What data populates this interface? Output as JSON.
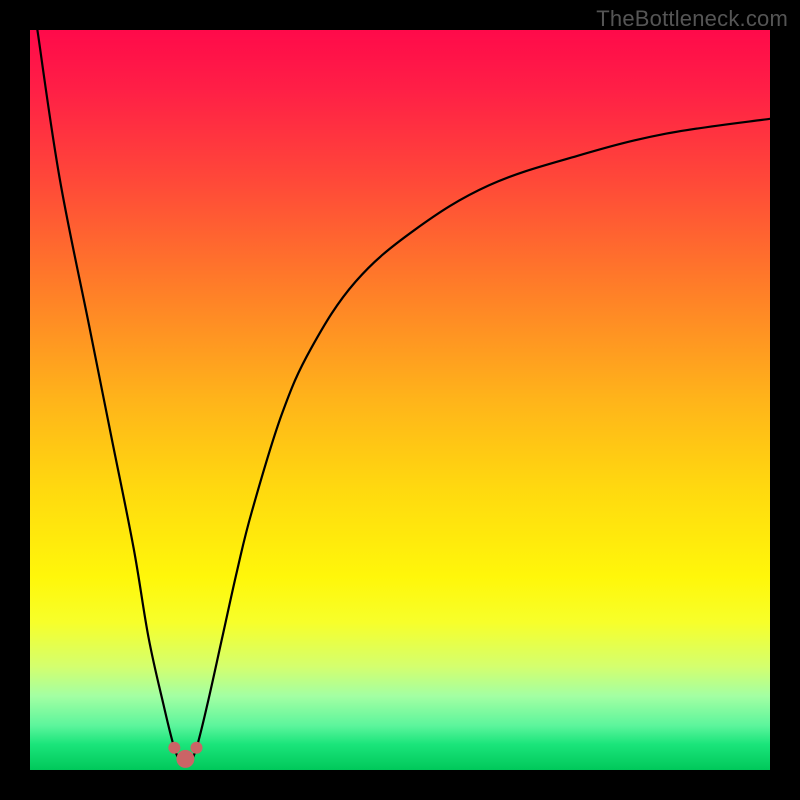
{
  "watermark": "TheBottleneck.com",
  "chart_data": {
    "type": "line",
    "title": "",
    "xlabel": "",
    "ylabel": "",
    "xlim": [
      0,
      100
    ],
    "ylim": [
      0,
      100
    ],
    "background_gradient_stops": [
      {
        "offset": 0.0,
        "color": "#ff0a4a"
      },
      {
        "offset": 0.08,
        "color": "#ff1f46"
      },
      {
        "offset": 0.2,
        "color": "#ff4739"
      },
      {
        "offset": 0.35,
        "color": "#ff7e28"
      },
      {
        "offset": 0.5,
        "color": "#ffb41a"
      },
      {
        "offset": 0.62,
        "color": "#ffd90f"
      },
      {
        "offset": 0.74,
        "color": "#fff70a"
      },
      {
        "offset": 0.8,
        "color": "#f7ff2a"
      },
      {
        "offset": 0.86,
        "color": "#d4ff6e"
      },
      {
        "offset": 0.9,
        "color": "#a3ffa3"
      },
      {
        "offset": 0.94,
        "color": "#5cf59c"
      },
      {
        "offset": 0.965,
        "color": "#1be57b"
      },
      {
        "offset": 1.0,
        "color": "#00c85a"
      }
    ],
    "series": [
      {
        "name": "bottleneck-curve",
        "x": [
          1,
          4,
          8,
          11,
          14,
          16,
          18,
          19.5,
          20.5,
          21.5,
          22.5,
          24,
          26,
          28,
          30,
          34,
          38,
          44,
          52,
          62,
          74,
          86,
          100
        ],
        "values": [
          100,
          80,
          60,
          45,
          30,
          18,
          9,
          3,
          1,
          1,
          3,
          9,
          18,
          27,
          35,
          48,
          57,
          66,
          73,
          79,
          83,
          86,
          88
        ]
      }
    ],
    "markers": [
      {
        "name": "min-left",
        "x": 19.5,
        "y": 3,
        "color": "#cb6466",
        "r": 6
      },
      {
        "name": "min-right",
        "x": 22.5,
        "y": 3,
        "color": "#cb6466",
        "r": 6
      },
      {
        "name": "min-bottom",
        "x": 21.0,
        "y": 1.5,
        "color": "#cb6466",
        "r": 9
      }
    ]
  }
}
